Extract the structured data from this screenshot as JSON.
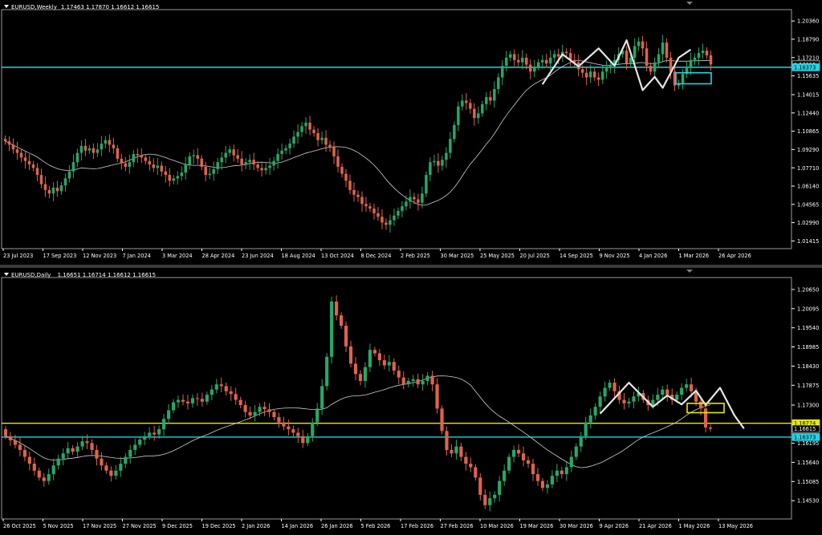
{
  "colors": {
    "bull": "#26a86a",
    "bear": "#e0634a",
    "ma": "#cfcfcf",
    "cyan": "#21d4e6",
    "yellow": "#e8e800",
    "axis": "#ffffff",
    "grid_text": "#ffffff",
    "zigzag": "#e6e6e6"
  },
  "chart_data": [
    {
      "type": "candlestick",
      "title": "EURUSD,Weekly",
      "ohlc_header": "1.17463 1.17870 1.16612 1.16615",
      "ylim": [
        1.0075,
        1.212
      ],
      "y_ticks": [
        "1.20360",
        "1.18790",
        "1.17210",
        "1.15635",
        "1.14015",
        "1.12440",
        "1.10865",
        "1.09290",
        "1.07710",
        "1.06140",
        "1.04565",
        "1.02990",
        "1.01415"
      ],
      "x_ticks": [
        "23 Jul 2023",
        "17 Sep 2023",
        "12 Nov 2023",
        "7 Jan 2024",
        "3 Mar 2024",
        "28 Apr 2024",
        "23 Jun 2024",
        "18 Aug 2024",
        "13 Oct 2024",
        "8 Dec 2024",
        "2 Feb 2025",
        "30 Mar 2025",
        "25 May 2025",
        "20 Jul 2025",
        "14 Sep 2025",
        "9 Nov 2025",
        "4 Jan 2026",
        "1 Mar 2026",
        "26 Apr 2026"
      ],
      "price_labels": [
        {
          "text": "1.16615",
          "level": 1.16615,
          "color": "#ffffff"
        },
        {
          "text": "1.16373",
          "level": 1.16373,
          "color": "#21d4e6"
        }
      ],
      "hlines": [
        {
          "level": 1.16373,
          "color": "#21d4e6"
        }
      ],
      "target_box": {
        "from": 1.159,
        "to": 1.1495,
        "color": "#21d4e6"
      },
      "closes": [
        1.1,
        1.097,
        1.093,
        1.09,
        1.086,
        1.083,
        1.08,
        1.077,
        1.071,
        1.063,
        1.058,
        1.055,
        1.06,
        1.057,
        1.062,
        1.068,
        1.074,
        1.082,
        1.09,
        1.096,
        1.092,
        1.094,
        1.09,
        1.093,
        1.098,
        1.101,
        1.097,
        1.094,
        1.085,
        1.081,
        1.078,
        1.082,
        1.089,
        1.088,
        1.086,
        1.083,
        1.08,
        1.077,
        1.079,
        1.074,
        1.071,
        1.066,
        1.068,
        1.07,
        1.073,
        1.08,
        1.087,
        1.088,
        1.085,
        1.078,
        1.071,
        1.072,
        1.076,
        1.082,
        1.086,
        1.09,
        1.093,
        1.088,
        1.085,
        1.08,
        1.082,
        1.084,
        1.08,
        1.077,
        1.075,
        1.077,
        1.079,
        1.083,
        1.089,
        1.092,
        1.094,
        1.098,
        1.104,
        1.108,
        1.113,
        1.116,
        1.11,
        1.107,
        1.101,
        1.103,
        1.097,
        1.095,
        1.087,
        1.078,
        1.072,
        1.066,
        1.058,
        1.054,
        1.052,
        1.046,
        1.044,
        1.042,
        1.038,
        1.035,
        1.03,
        1.028,
        1.032,
        1.036,
        1.04,
        1.044,
        1.048,
        1.052,
        1.05,
        1.047,
        1.055,
        1.071,
        1.082,
        1.083,
        1.079,
        1.084,
        1.09,
        1.102,
        1.114,
        1.13,
        1.135,
        1.133,
        1.128,
        1.12,
        1.124,
        1.132,
        1.138,
        1.135,
        1.145,
        1.155,
        1.165,
        1.172,
        1.175,
        1.17,
        1.168,
        1.172,
        1.166,
        1.16,
        1.164,
        1.168,
        1.17,
        1.167,
        1.172,
        1.175,
        1.173,
        1.177,
        1.176,
        1.17,
        1.168,
        1.162,
        1.159,
        1.155,
        1.16,
        1.155,
        1.153,
        1.16,
        1.163,
        1.165,
        1.17,
        1.175,
        1.178,
        1.167,
        1.172,
        1.182,
        1.186,
        1.18,
        1.165,
        1.16,
        1.168,
        1.175,
        1.185,
        1.172,
        1.16,
        1.148,
        1.15,
        1.158,
        1.163,
        1.17,
        1.172,
        1.176,
        1.178,
        1.174,
        1.16615
      ],
      "zigzag": [
        [
          134,
          1.149
        ],
        [
          139,
          1.175
        ],
        [
          143,
          1.1645
        ],
        [
          148,
          1.18
        ],
        [
          152,
          1.165
        ],
        [
          155,
          1.187
        ],
        [
          159,
          1.144
        ],
        [
          162,
          1.1555
        ],
        [
          164,
          1.146
        ],
        [
          168,
          1.172
        ],
        [
          171,
          1.179
        ]
      ]
    },
    {
      "type": "candlestick",
      "title": "EURUSD,Daily",
      "ohlc_header": "1.16651 1.16714 1.16612 1.16615",
      "ylim": [
        1.14,
        1.2095
      ],
      "y_ticks": [
        "1.20650",
        "1.20095",
        "1.19540",
        "1.18985",
        "1.18430",
        "1.17875",
        "1.17300",
        "1.16745",
        "1.16195",
        "1.15640",
        "1.15085",
        "1.14530"
      ],
      "x_ticks": [
        "26 Oct 2025",
        "5 Nov 2025",
        "17 Nov 2025",
        "27 Nov 2025",
        "9 Dec 2025",
        "19 Dec 2025",
        "2 Jan 2026",
        "14 Jan 2026",
        "26 Jan 2026",
        "5 Feb 2026",
        "17 Feb 2026",
        "27 Feb 2026",
        "10 Mar 2026",
        "19 Mar 2026",
        "30 Mar 2026",
        "9 Apr 2026",
        "21 Apr 2026",
        "1 May 2026",
        "13 May 2026"
      ],
      "price_labels": [
        {
          "text": "1.16774",
          "level": 1.16774,
          "color": "#e8e800"
        },
        {
          "text": "1.16615",
          "level": 1.16615,
          "color": "#ffffff"
        },
        {
          "text": "1.16373",
          "level": 1.16373,
          "color": "#21d4e6"
        }
      ],
      "hlines": [
        {
          "level": 1.16774,
          "color": "#e8e800"
        },
        {
          "level": 1.16373,
          "color": "#21d4e6"
        }
      ],
      "target_box": {
        "from": 1.1735,
        "to": 1.1708,
        "color": "#e8e800"
      },
      "closes": [
        1.164,
        1.1628,
        1.1615,
        1.16,
        1.158,
        1.156,
        1.154,
        1.152,
        1.151,
        1.153,
        1.1555,
        1.1575,
        1.159,
        1.1605,
        1.1595,
        1.161,
        1.1625,
        1.162,
        1.16,
        1.1575,
        1.1555,
        1.154,
        1.1525,
        1.154,
        1.156,
        1.158,
        1.16,
        1.1615,
        1.163,
        1.164,
        1.165,
        1.1645,
        1.166,
        1.169,
        1.1715,
        1.1738,
        1.1745,
        1.174,
        1.1735,
        1.175,
        1.1748,
        1.174,
        1.176,
        1.1775,
        1.179,
        1.1785,
        1.177,
        1.1762,
        1.1745,
        1.173,
        1.171,
        1.17,
        1.171,
        1.1725,
        1.1718,
        1.171,
        1.1695,
        1.168,
        1.1668,
        1.166,
        1.165,
        1.164,
        1.162,
        1.164,
        1.168,
        1.172,
        1.1785,
        1.187,
        1.203,
        1.199,
        1.196,
        1.19,
        1.185,
        1.182,
        1.18,
        1.184,
        1.189,
        1.188,
        1.186,
        1.1845,
        1.1855,
        1.183,
        1.181,
        1.179,
        1.18,
        1.1805,
        1.179,
        1.18,
        1.1815,
        1.179,
        1.172,
        1.1655,
        1.16,
        1.159,
        1.161,
        1.158,
        1.156,
        1.155,
        1.152,
        1.147,
        1.144,
        1.146,
        1.147,
        1.151,
        1.154,
        1.158,
        1.16,
        1.159,
        1.157,
        1.156,
        1.153,
        1.151,
        1.149,
        1.15,
        1.1525,
        1.154,
        1.153,
        1.155,
        1.158,
        1.161,
        1.164,
        1.168,
        1.17,
        1.1725,
        1.1755,
        1.178,
        1.1795,
        1.177,
        1.1745,
        1.1735,
        1.174,
        1.1755,
        1.1765,
        1.1745,
        1.173,
        1.1745,
        1.176,
        1.1775,
        1.176,
        1.1745,
        1.176,
        1.178,
        1.179,
        1.177,
        1.174,
        1.172,
        1.16651,
        1.16615
      ],
      "zigzag": [
        [
          124,
          1.1705
        ],
        [
          130,
          1.1795
        ],
        [
          135,
          1.1725
        ],
        [
          138,
          1.1758
        ],
        [
          141,
          1.1732
        ],
        [
          144,
          1.1772
        ],
        [
          146,
          1.173
        ],
        [
          149,
          1.178
        ],
        [
          152,
          1.17
        ],
        [
          154,
          1.1662
        ]
      ]
    }
  ]
}
